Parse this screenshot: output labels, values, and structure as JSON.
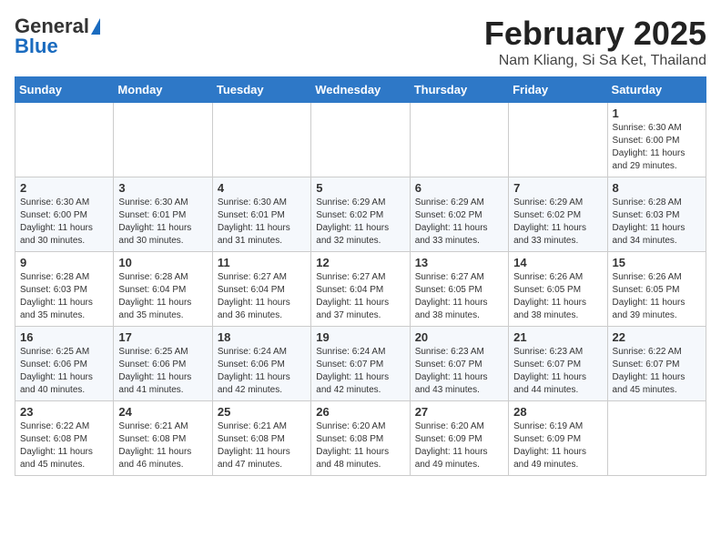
{
  "header": {
    "logo_general": "General",
    "logo_blue": "Blue",
    "title": "February 2025",
    "subtitle": "Nam Kliang, Si Sa Ket, Thailand"
  },
  "weekdays": [
    "Sunday",
    "Monday",
    "Tuesday",
    "Wednesday",
    "Thursday",
    "Friday",
    "Saturday"
  ],
  "weeks": [
    [
      {
        "day": "",
        "info": ""
      },
      {
        "day": "",
        "info": ""
      },
      {
        "day": "",
        "info": ""
      },
      {
        "day": "",
        "info": ""
      },
      {
        "day": "",
        "info": ""
      },
      {
        "day": "",
        "info": ""
      },
      {
        "day": "1",
        "info": "Sunrise: 6:30 AM\nSunset: 6:00 PM\nDaylight: 11 hours\nand 29 minutes."
      }
    ],
    [
      {
        "day": "2",
        "info": "Sunrise: 6:30 AM\nSunset: 6:00 PM\nDaylight: 11 hours\nand 30 minutes."
      },
      {
        "day": "3",
        "info": "Sunrise: 6:30 AM\nSunset: 6:01 PM\nDaylight: 11 hours\nand 30 minutes."
      },
      {
        "day": "4",
        "info": "Sunrise: 6:30 AM\nSunset: 6:01 PM\nDaylight: 11 hours\nand 31 minutes."
      },
      {
        "day": "5",
        "info": "Sunrise: 6:29 AM\nSunset: 6:02 PM\nDaylight: 11 hours\nand 32 minutes."
      },
      {
        "day": "6",
        "info": "Sunrise: 6:29 AM\nSunset: 6:02 PM\nDaylight: 11 hours\nand 33 minutes."
      },
      {
        "day": "7",
        "info": "Sunrise: 6:29 AM\nSunset: 6:02 PM\nDaylight: 11 hours\nand 33 minutes."
      },
      {
        "day": "8",
        "info": "Sunrise: 6:28 AM\nSunset: 6:03 PM\nDaylight: 11 hours\nand 34 minutes."
      }
    ],
    [
      {
        "day": "9",
        "info": "Sunrise: 6:28 AM\nSunset: 6:03 PM\nDaylight: 11 hours\nand 35 minutes."
      },
      {
        "day": "10",
        "info": "Sunrise: 6:28 AM\nSunset: 6:04 PM\nDaylight: 11 hours\nand 35 minutes."
      },
      {
        "day": "11",
        "info": "Sunrise: 6:27 AM\nSunset: 6:04 PM\nDaylight: 11 hours\nand 36 minutes."
      },
      {
        "day": "12",
        "info": "Sunrise: 6:27 AM\nSunset: 6:04 PM\nDaylight: 11 hours\nand 37 minutes."
      },
      {
        "day": "13",
        "info": "Sunrise: 6:27 AM\nSunset: 6:05 PM\nDaylight: 11 hours\nand 38 minutes."
      },
      {
        "day": "14",
        "info": "Sunrise: 6:26 AM\nSunset: 6:05 PM\nDaylight: 11 hours\nand 38 minutes."
      },
      {
        "day": "15",
        "info": "Sunrise: 6:26 AM\nSunset: 6:05 PM\nDaylight: 11 hours\nand 39 minutes."
      }
    ],
    [
      {
        "day": "16",
        "info": "Sunrise: 6:25 AM\nSunset: 6:06 PM\nDaylight: 11 hours\nand 40 minutes."
      },
      {
        "day": "17",
        "info": "Sunrise: 6:25 AM\nSunset: 6:06 PM\nDaylight: 11 hours\nand 41 minutes."
      },
      {
        "day": "18",
        "info": "Sunrise: 6:24 AM\nSunset: 6:06 PM\nDaylight: 11 hours\nand 42 minutes."
      },
      {
        "day": "19",
        "info": "Sunrise: 6:24 AM\nSunset: 6:07 PM\nDaylight: 11 hours\nand 42 minutes."
      },
      {
        "day": "20",
        "info": "Sunrise: 6:23 AM\nSunset: 6:07 PM\nDaylight: 11 hours\nand 43 minutes."
      },
      {
        "day": "21",
        "info": "Sunrise: 6:23 AM\nSunset: 6:07 PM\nDaylight: 11 hours\nand 44 minutes."
      },
      {
        "day": "22",
        "info": "Sunrise: 6:22 AM\nSunset: 6:07 PM\nDaylight: 11 hours\nand 45 minutes."
      }
    ],
    [
      {
        "day": "23",
        "info": "Sunrise: 6:22 AM\nSunset: 6:08 PM\nDaylight: 11 hours\nand 45 minutes."
      },
      {
        "day": "24",
        "info": "Sunrise: 6:21 AM\nSunset: 6:08 PM\nDaylight: 11 hours\nand 46 minutes."
      },
      {
        "day": "25",
        "info": "Sunrise: 6:21 AM\nSunset: 6:08 PM\nDaylight: 11 hours\nand 47 minutes."
      },
      {
        "day": "26",
        "info": "Sunrise: 6:20 AM\nSunset: 6:08 PM\nDaylight: 11 hours\nand 48 minutes."
      },
      {
        "day": "27",
        "info": "Sunrise: 6:20 AM\nSunset: 6:09 PM\nDaylight: 11 hours\nand 49 minutes."
      },
      {
        "day": "28",
        "info": "Sunrise: 6:19 AM\nSunset: 6:09 PM\nDaylight: 11 hours\nand 49 minutes."
      },
      {
        "day": "",
        "info": ""
      }
    ]
  ]
}
